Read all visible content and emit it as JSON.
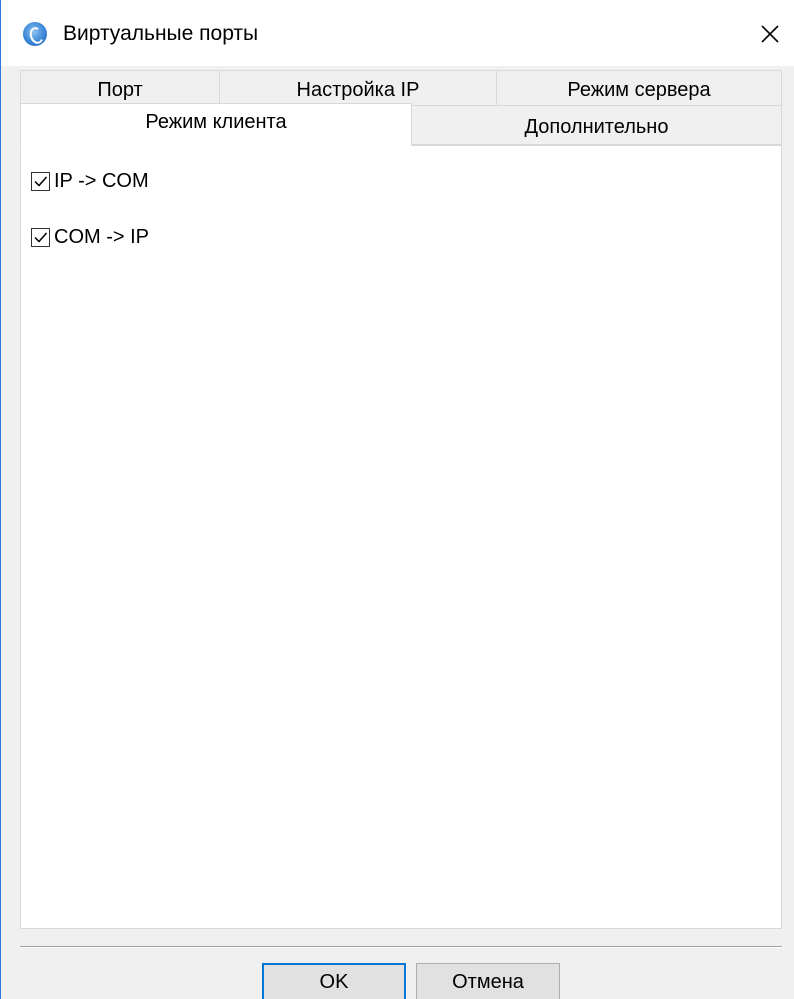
{
  "window": {
    "title": "Виртуальные порты",
    "accent_color": "#0078d7",
    "icon": "app-globe-icon",
    "close_icon": "close-icon"
  },
  "tabs": {
    "row1": [
      {
        "label": "Порт"
      },
      {
        "label": "Настройка IP"
      },
      {
        "label": "Режим сервера"
      }
    ],
    "row2": [
      {
        "label": "Режим клиента",
        "active": true
      },
      {
        "label": "Дополнительно",
        "active": false
      }
    ]
  },
  "client_mode": {
    "options": [
      {
        "label": "IP -> COM",
        "checked": true
      },
      {
        "label": "COM -> IP",
        "checked": true
      }
    ]
  },
  "buttons": {
    "ok": "OK",
    "cancel": "Отмена"
  }
}
